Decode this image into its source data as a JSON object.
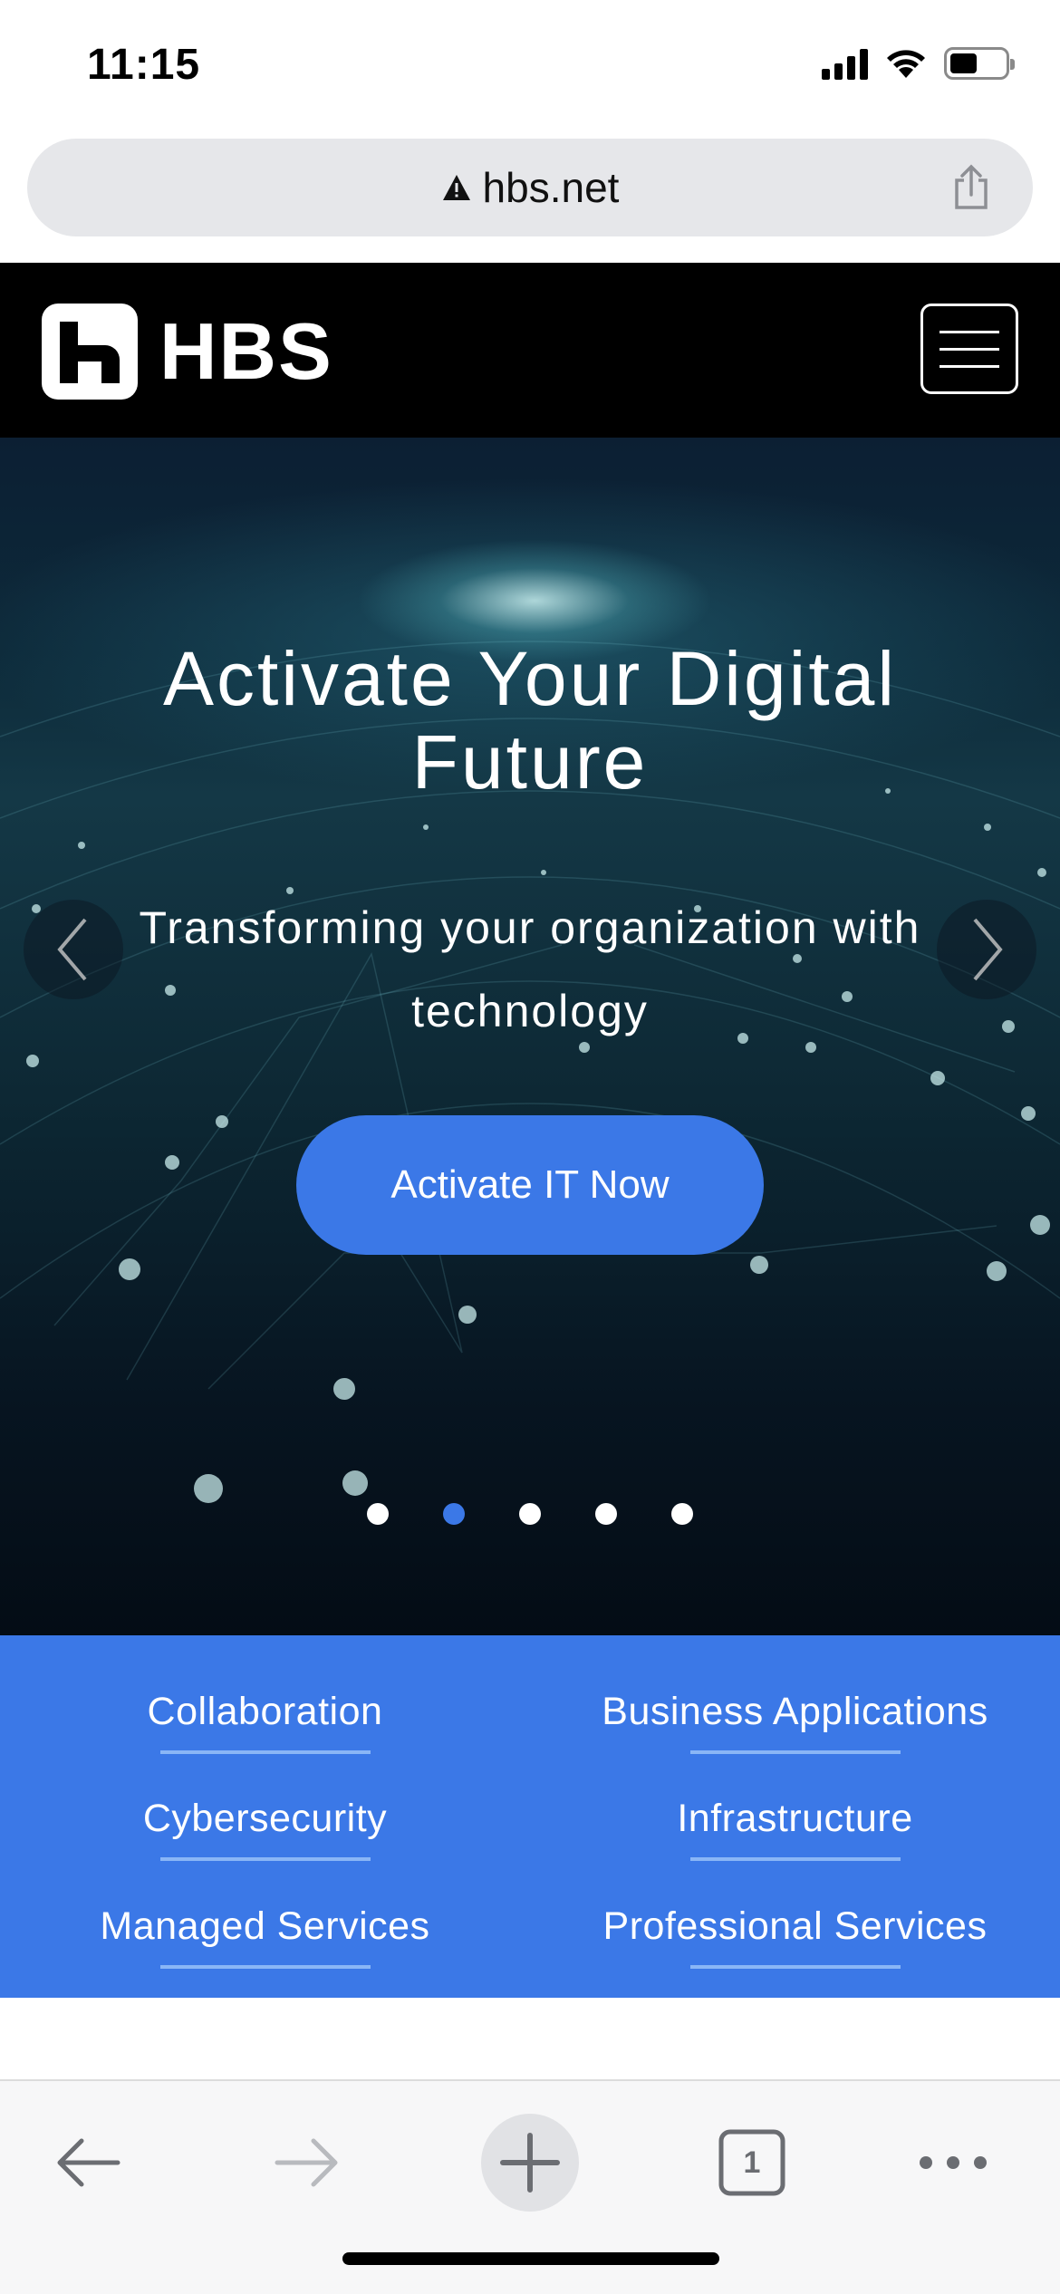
{
  "status_bar": {
    "time": "11:15"
  },
  "browser": {
    "url": "hbs.net",
    "tab_count": "1"
  },
  "site": {
    "logo_text": "HBS"
  },
  "hero": {
    "title": "Activate Your Digital Future",
    "subtitle": "Transforming your organization with technology",
    "cta_label": "Activate IT Now",
    "active_slide": 2,
    "slide_count": 5
  },
  "services": {
    "items": [
      {
        "label": "Collaboration"
      },
      {
        "label": "Business Applications"
      },
      {
        "label": "Cybersecurity"
      },
      {
        "label": "Infrastructure"
      },
      {
        "label": "Managed Services"
      },
      {
        "label": "Professional Services"
      }
    ]
  },
  "colors": {
    "accent": "#3b78e7",
    "header_bg": "#000000",
    "toolbar_bg": "#f7f7f8"
  },
  "icons": [
    "warning-icon",
    "share-icon",
    "hamburger-menu-icon",
    "chevron-left-icon",
    "chevron-right-icon",
    "back-arrow-icon",
    "forward-arrow-icon",
    "plus-icon",
    "tabs-icon",
    "more-icon"
  ]
}
